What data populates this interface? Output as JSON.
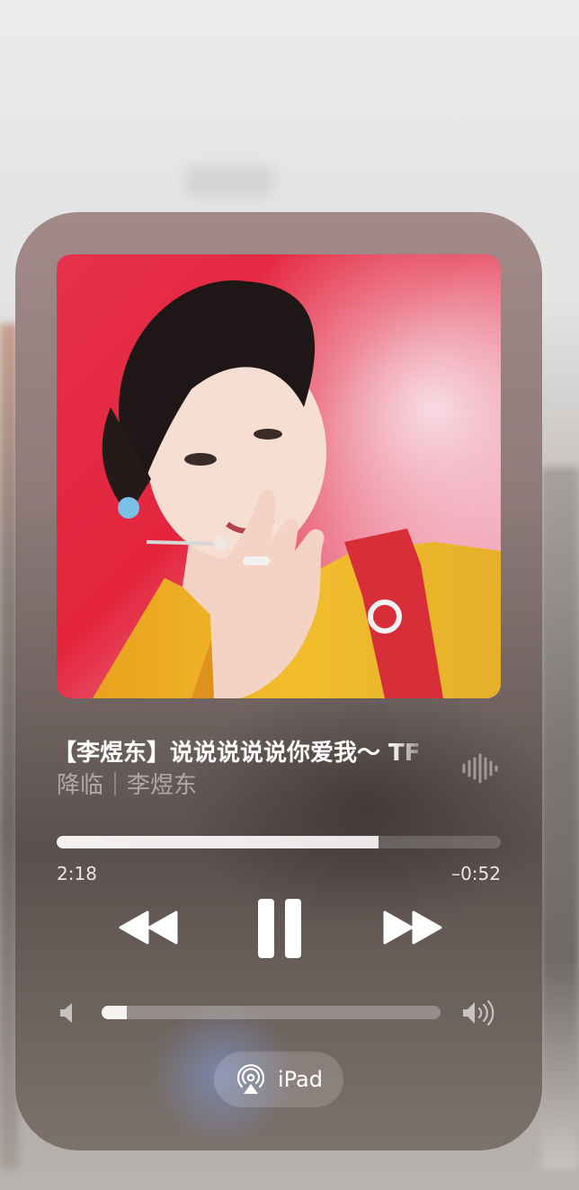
{
  "now_playing": {
    "title": "【李煜东】说说说说说你爱我～ TF",
    "subtitle": "降临｜李煜东",
    "artwork_icon": "album-artwork-photo",
    "waveform_icon": "waveform-icon",
    "progress_fraction": 0.725,
    "elapsed": "2:18",
    "remaining": "–0:52"
  },
  "controls": {
    "rewind_icon": "rewind-icon",
    "pause_icon": "pause-icon",
    "forward_icon": "fast-forward-icon"
  },
  "volume": {
    "level_fraction": 0.075,
    "low_icon": "speaker-low-icon",
    "high_icon": "speaker-high-icon"
  },
  "airplay": {
    "label": "iPad",
    "icon": "airplay-audio-icon"
  },
  "colors": {
    "accent_glow": "#82a0e6",
    "progress_fill": "#f4f1f1"
  }
}
